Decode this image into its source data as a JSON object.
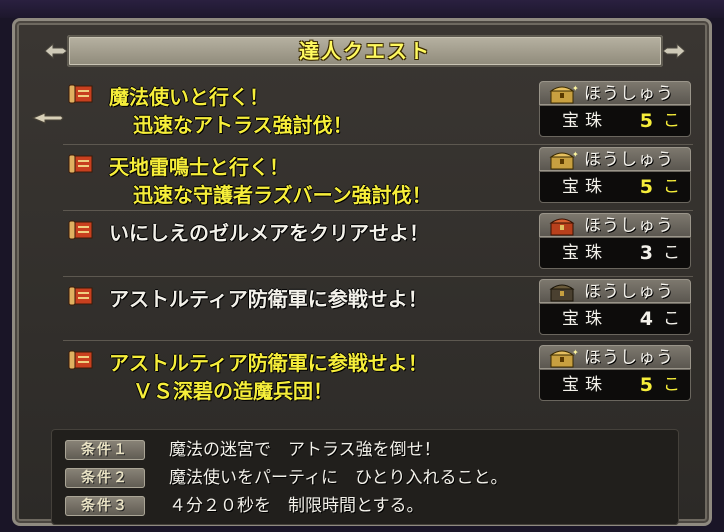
{
  "window": {
    "title": "達人クエスト"
  },
  "quests": [
    {
      "lines": [
        "魔法使いと行く！",
        "迅速なアトラス強討伐！"
      ],
      "highlighted": true,
      "reward": {
        "header": "ほうしゅう",
        "item": "宝珠",
        "count": "5",
        "unit": "こ",
        "count_color": "#f6ee3a",
        "chest": "gold-chest-icon"
      }
    },
    {
      "lines": [
        "天地雷鳴士と行く！",
        "迅速な守護者ラズバーン強討伐！"
      ],
      "highlighted": true,
      "reward": {
        "header": "ほうしゅう",
        "item": "宝珠",
        "count": "5",
        "unit": "こ",
        "count_color": "#f6ee3a",
        "chest": "gold-chest-icon"
      }
    },
    {
      "lines": [
        "いにしえのゼルメアをクリアせよ！"
      ],
      "highlighted": false,
      "reward": {
        "header": "ほうしゅう",
        "item": "宝珠",
        "count": "3",
        "unit": "こ",
        "count_color": "#f3f1ea",
        "chest": "red-chest-icon"
      }
    },
    {
      "lines": [
        "アストルティア防衛軍に参戦せよ！"
      ],
      "highlighted": false,
      "reward": {
        "header": "ほうしゅう",
        "item": "宝珠",
        "count": "4",
        "unit": "こ",
        "count_color": "#f3f1ea",
        "chest": "dark-chest-icon"
      }
    },
    {
      "lines": [
        "アストルティア防衛軍に参戦せよ！",
        "ＶＳ深碧の造魔兵団！"
      ],
      "highlighted": true,
      "reward": {
        "header": "ほうしゅう",
        "item": "宝珠",
        "count": "5",
        "unit": "こ",
        "count_color": "#f6ee3a",
        "chest": "gold-chest-icon"
      }
    }
  ],
  "conditions": [
    {
      "badge": "条件１",
      "text": "魔法の迷宮で　アトラス強を倒せ！"
    },
    {
      "badge": "条件２",
      "text": "魔法使いをパーティに　ひとり入れること。"
    },
    {
      "badge": "条件３",
      "text": "４分２０秒を　制限時間とする。"
    }
  ],
  "colors": {
    "highlight_text": "#f6ee3a",
    "normal_text": "#f3f1ea",
    "title_text": "#fffa60"
  }
}
